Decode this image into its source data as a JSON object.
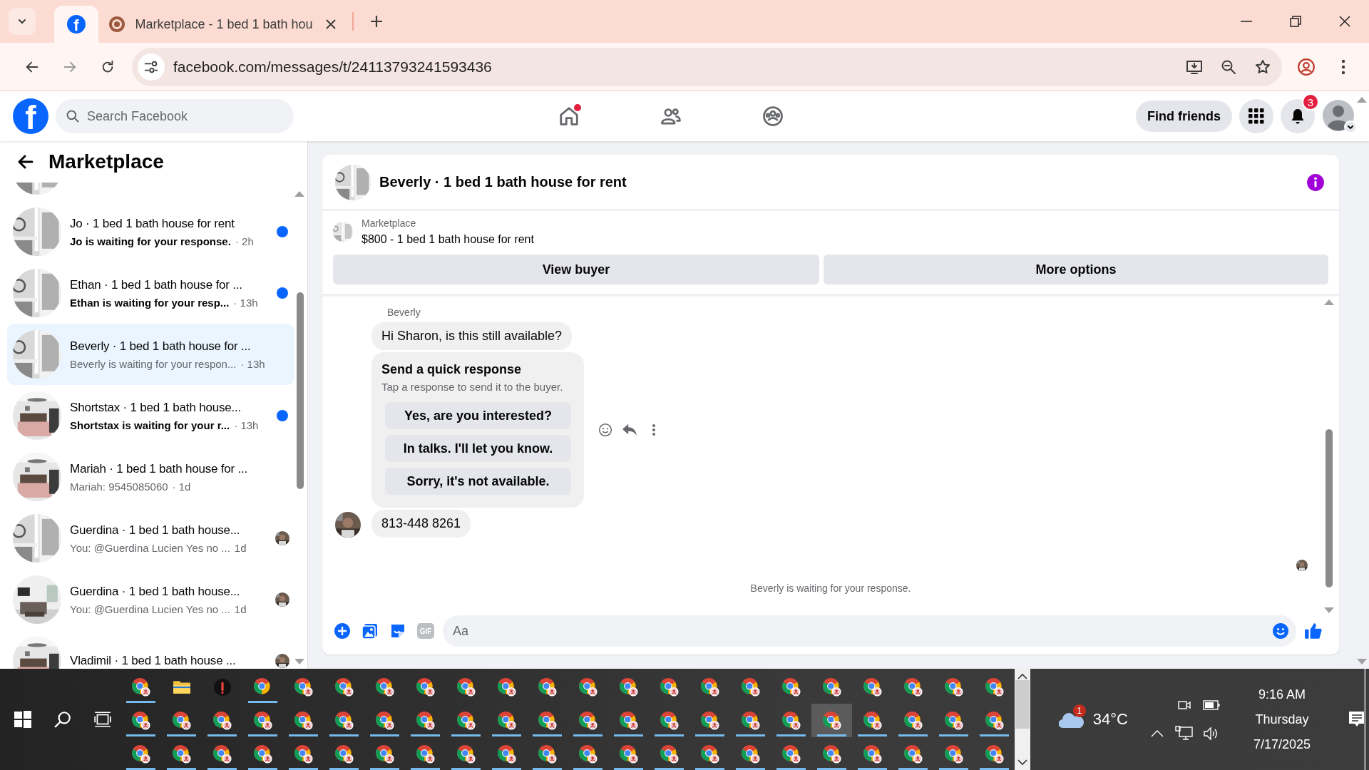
{
  "browser": {
    "tabs": [
      {
        "favicon": "f",
        "selected": true
      },
      {
        "title": "Marketplace - 1 bed 1 bath hou",
        "selected": false
      }
    ],
    "url": "facebook.com/messages/t/24113793241593436"
  },
  "header": {
    "logo": "f",
    "search": {
      "placeholder": "Search Facebook"
    },
    "home_notification": true,
    "find_friends": "Find friends",
    "notifications_badge": "3"
  },
  "sidebar": {
    "title": "Marketplace",
    "conversations": [
      {
        "selected": false
      },
      {
        "title": "Jo · 1 bed 1 bath house for rent",
        "preview": "Jo is waiting for your response.",
        "time": "· 2h",
        "unread": true,
        "selected": false,
        "seen": false
      },
      {
        "title": "Ethan · 1 bed 1 bath house for ...",
        "preview": "Ethan is waiting for your resp...",
        "time": "· 13h",
        "unread": true,
        "selected": false,
        "seen": false
      },
      {
        "title": "Beverly · 1 bed 1 bath house for ...",
        "preview": "Beverly is waiting for your respon...",
        "time": "· 13h",
        "unread": false,
        "selected": true,
        "seen": false
      },
      {
        "title": "Shortstax · 1 bed 1 bath house...",
        "preview": "Shortstax is waiting for your r...",
        "time": "· 13h",
        "unread": true,
        "selected": false,
        "seen": false
      },
      {
        "title": "Mariah · 1 bed 1 bath house for ...",
        "preview": "Mariah: 9545085060",
        "time": "· 1d",
        "unread": false,
        "selected": false,
        "seen": false
      },
      {
        "title": "Guerdina · 1 bed 1 bath house...",
        "preview": "You: @Guerdina Lucien Yes no ...",
        "time": "1d",
        "unread": false,
        "selected": false,
        "seen": true
      },
      {
        "title": "Guerdina · 1 bed 1 bath house...",
        "preview": "You: @Guerdina Lucien Yes no ...",
        "time": "1d",
        "unread": false,
        "selected": false,
        "seen": true
      },
      {
        "title": "Vladimil · 1 bed 1 bath house ...",
        "unread": false,
        "selected": false,
        "seen": true
      }
    ]
  },
  "chat": {
    "title": "Beverly · 1 bed 1 bath house for rent",
    "listing": {
      "source": "Marketplace",
      "item": "$800 - 1 bed 1 bath house for rent"
    },
    "buttons": [
      "View buyer",
      "More options"
    ],
    "messages": [
      {
        "kind": "text",
        "sender": "Beverly",
        "text": "Hi Sharon, is this still available?"
      },
      {
        "kind": "quick_responses",
        "title": "Send a quick response",
        "subtitle": "Tap a response to send it to the buyer.",
        "options": [
          "Yes, are you interested?",
          "In talks. I'll let you know.",
          "Sorry, it's not available."
        ]
      },
      {
        "kind": "text",
        "avatar": true,
        "text": "813-448 8261"
      }
    ],
    "status": "Beverly is waiting for your response.",
    "composer": {
      "gif": "GIF",
      "placeholder": "Aa"
    }
  },
  "taskbar": {
    "apps": [
      [
        {
          "kind": "browser-profile",
          "running": true,
          "selected": false
        },
        {
          "kind": "folder",
          "running": false,
          "selected": false
        },
        {
          "kind": "app",
          "running": false,
          "selected": false
        },
        {
          "kind": "browser",
          "running": true,
          "selected": false
        },
        {
          "kind": "browser-profile",
          "running": false,
          "selected": false
        },
        {
          "kind": "browser-profile",
          "running": false,
          "selected": false
        },
        {
          "kind": "browser-profile",
          "running": false,
          "selected": false
        },
        {
          "kind": "browser-profile",
          "running": false,
          "selected": false
        },
        {
          "kind": "browser-profile",
          "running": false,
          "selected": false
        },
        {
          "kind": "browser-profile",
          "running": false,
          "selected": false
        },
        {
          "kind": "browser-profile",
          "running": false,
          "selected": false
        },
        {
          "kind": "browser-profile",
          "running": false,
          "selected": false
        },
        {
          "kind": "browser-profile",
          "running": false,
          "selected": false
        },
        {
          "kind": "browser-profile",
          "running": false,
          "selected": false
        },
        {
          "kind": "browser-profile",
          "running": false,
          "selected": false
        },
        {
          "kind": "browser-profile",
          "running": false,
          "selected": false
        },
        {
          "kind": "browser-profile",
          "running": false,
          "selected": false
        },
        {
          "kind": "browser-profile",
          "running": false,
          "selected": false
        },
        {
          "kind": "browser-profile",
          "running": false,
          "selected": false
        },
        {
          "kind": "browser-profile",
          "running": false,
          "selected": false
        },
        {
          "kind": "browser-profile",
          "running": false,
          "selected": false
        },
        {
          "kind": "browser-profile",
          "running": false,
          "selected": false
        }
      ],
      [
        {
          "kind": "browser-profile",
          "running": true,
          "selected": false
        },
        {
          "kind": "browser-profile",
          "running": true,
          "selected": false
        },
        {
          "kind": "browser-profile",
          "running": true,
          "selected": false
        },
        {
          "kind": "browser-profile",
          "running": true,
          "selected": false
        },
        {
          "kind": "browser-profile",
          "running": true,
          "selected": false
        },
        {
          "kind": "browser-profile",
          "running": true,
          "selected": false
        },
        {
          "kind": "browser-profile",
          "running": true,
          "selected": false
        },
        {
          "kind": "browser-profile",
          "running": true,
          "selected": false
        },
        {
          "kind": "browser-profile",
          "running": true,
          "selected": false
        },
        {
          "kind": "browser-profile",
          "running": true,
          "selected": false
        },
        {
          "kind": "browser-profile",
          "running": true,
          "selected": false
        },
        {
          "kind": "browser-profile",
          "running": true,
          "selected": false
        },
        {
          "kind": "browser-profile",
          "running": true,
          "selected": false
        },
        {
          "kind": "browser-profile",
          "running": true,
          "selected": false
        },
        {
          "kind": "browser-profile",
          "running": true,
          "selected": false
        },
        {
          "kind": "browser-profile",
          "running": true,
          "selected": false
        },
        {
          "kind": "browser-profile",
          "running": true,
          "selected": false
        },
        {
          "kind": "browser-profile",
          "running": true,
          "selected": true
        },
        {
          "kind": "browser-profile",
          "running": true,
          "selected": false
        },
        {
          "kind": "browser-profile",
          "running": true,
          "selected": false
        },
        {
          "kind": "browser-profile",
          "running": true,
          "selected": false
        },
        {
          "kind": "browser-profile",
          "running": true,
          "selected": false
        }
      ],
      [
        {
          "kind": "browser-profile",
          "running": true,
          "selected": false
        },
        {
          "kind": "browser-profile",
          "running": true,
          "selected": false
        },
        {
          "kind": "browser-profile",
          "running": true,
          "selected": false
        },
        {
          "kind": "browser-profile",
          "running": true,
          "selected": false
        },
        {
          "kind": "browser-profile",
          "running": true,
          "selected": false
        },
        {
          "kind": "browser-profile",
          "running": true,
          "selected": false
        },
        {
          "kind": "browser-profile",
          "running": true,
          "selected": false
        },
        {
          "kind": "browser-profile",
          "running": true,
          "selected": false
        },
        {
          "kind": "browser-profile",
          "running": true,
          "selected": false
        },
        {
          "kind": "browser-profile",
          "running": true,
          "selected": false
        },
        {
          "kind": "browser-profile",
          "running": true,
          "selected": false
        },
        {
          "kind": "browser-profile",
          "running": true,
          "selected": false
        },
        {
          "kind": "browser-profile",
          "running": true,
          "selected": false
        },
        {
          "kind": "browser-profile",
          "running": true,
          "selected": false
        },
        {
          "kind": "browser-profile",
          "running": true,
          "selected": false
        },
        {
          "kind": "browser-profile",
          "running": true,
          "selected": false
        },
        {
          "kind": "browser-profile",
          "running": true,
          "selected": false
        },
        {
          "kind": "browser-profile",
          "running": true,
          "selected": false
        },
        {
          "kind": "browser-profile",
          "running": true,
          "selected": false
        },
        {
          "kind": "browser-profile",
          "running": true,
          "selected": false
        },
        {
          "kind": "browser-profile",
          "running": true,
          "selected": false
        },
        {
          "kind": "browser-profile",
          "running": true,
          "selected": false
        }
      ]
    ],
    "weather": {
      "temperature": "34°C",
      "badge": "1"
    },
    "clock": {
      "time": "9:16 AM",
      "day": "Thursday",
      "date": "7/17/2025"
    }
  }
}
